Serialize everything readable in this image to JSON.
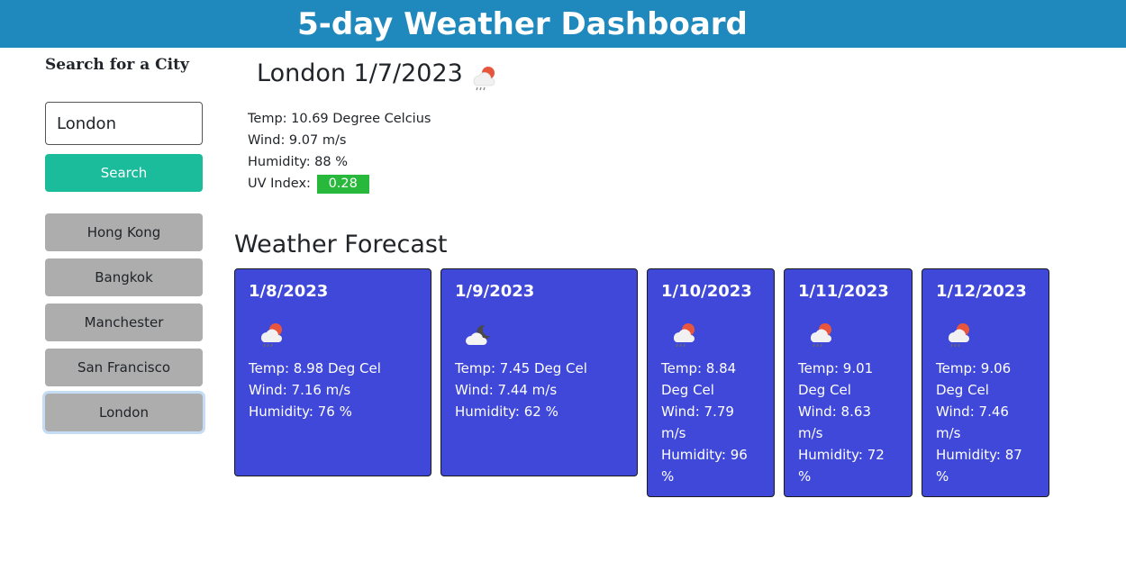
{
  "header": {
    "title": "5-day Weather Dashboard"
  },
  "sidebar": {
    "search_label": "Search for a City",
    "search_value": "London",
    "search_button": "Search",
    "history": [
      {
        "label": "Hong Kong"
      },
      {
        "label": "Bangkok"
      },
      {
        "label": "Manchester"
      },
      {
        "label": "San Francisco"
      },
      {
        "label": "London"
      }
    ]
  },
  "current": {
    "title": "London 1/7/2023",
    "icon": "rain-cloud-sun-icon",
    "temp": "Temp: 10.69 Degree Celcius",
    "wind": "Wind: 9.07 m/s",
    "humidity": "Humidity: 88 %",
    "uv_label": "UV Index:",
    "uv_value": "0.28",
    "uv_color": "#28b83c"
  },
  "forecast": {
    "title": "Weather Forecast",
    "card_color": "#3f48d8",
    "days": [
      {
        "date": "1/8/2023",
        "icon": "rain-cloud-sun-icon",
        "temp": "Temp: 8.98 Deg Cel",
        "wind": "Wind: 7.16 m/s",
        "humidity": "Humidity: 76 %"
      },
      {
        "date": "1/9/2023",
        "icon": "cloud-moon-icon",
        "temp": "Temp: 7.45 Deg Cel",
        "wind": "Wind: 7.44 m/s",
        "humidity": "Humidity: 62 %"
      },
      {
        "date": "1/10/2023",
        "icon": "rain-cloud-sun-icon",
        "temp": "Temp: 8.84 Deg Cel",
        "wind": "Wind: 7.79 m/s",
        "humidity": "Humidity: 96 %"
      },
      {
        "date": "1/11/2023",
        "icon": "rain-cloud-sun-icon",
        "temp": "Temp: 9.01 Deg Cel",
        "wind": "Wind: 8.63 m/s",
        "humidity": "Humidity: 72 %"
      },
      {
        "date": "1/12/2023",
        "icon": "rain-cloud-sun-icon",
        "temp": "Temp: 9.06 Deg Cel",
        "wind": "Wind: 7.46 m/s",
        "humidity": "Humidity: 87 %"
      }
    ]
  }
}
